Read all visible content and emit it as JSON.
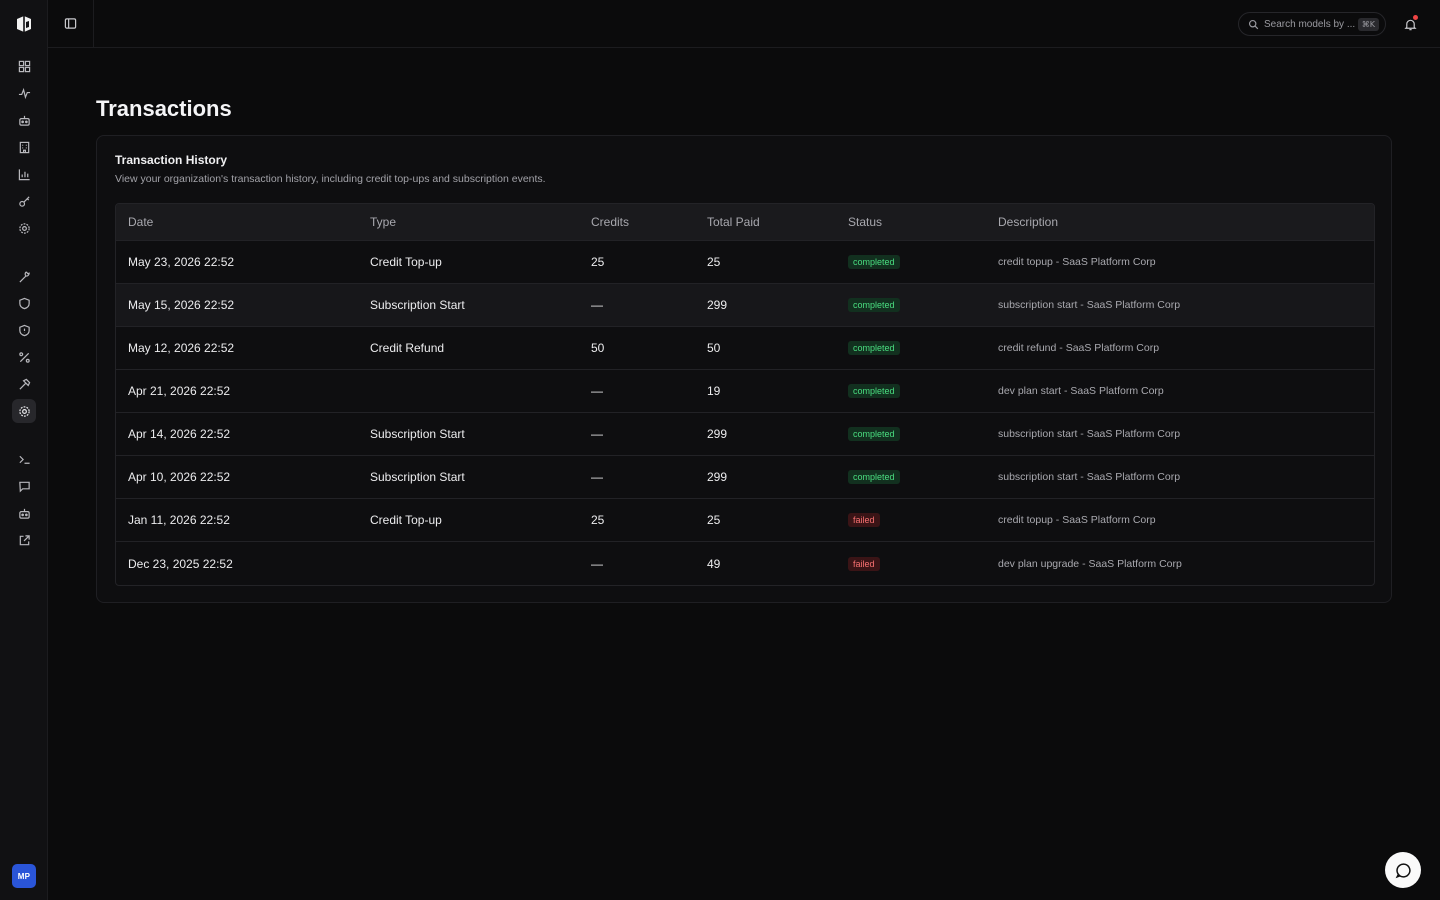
{
  "colors": {
    "background": "#0b0b0c",
    "sidebar": "#111113",
    "accent": "#2a55d8",
    "completed": "#4ade80",
    "failed": "#f87171",
    "notification": "#ef4444"
  },
  "sidebar": {
    "items": [
      {
        "icon": "dashboard-icon"
      },
      {
        "icon": "activity-icon"
      },
      {
        "icon": "bot-icon"
      },
      {
        "icon": "building-icon"
      },
      {
        "icon": "bar-chart-icon"
      },
      {
        "icon": "key-icon"
      },
      {
        "icon": "settings-icon"
      },
      {
        "icon": "wrench-icon"
      },
      {
        "icon": "shield-icon"
      },
      {
        "icon": "shield-alert-icon"
      },
      {
        "icon": "percent-icon"
      },
      {
        "icon": "hammer-icon"
      },
      {
        "icon": "settings-icon",
        "active": true
      },
      {
        "icon": "terminal-icon"
      },
      {
        "icon": "message-icon"
      },
      {
        "icon": "bot-icon"
      },
      {
        "icon": "external-link-icon"
      }
    ],
    "avatar_initials": "MP"
  },
  "topbar": {
    "search_placeholder": "Search models by ...",
    "search_shortcut": "⌘K"
  },
  "page": {
    "title": "Transactions"
  },
  "card": {
    "title": "Transaction History",
    "subtitle": "View your organization's transaction history, including credit top-ups and subscription events."
  },
  "table": {
    "columns": [
      "Date",
      "Type",
      "Credits",
      "Total Paid",
      "Status",
      "Description"
    ],
    "rows": [
      {
        "date": "May 23, 2026 22:52",
        "type": "Credit Top-up",
        "credits": "25",
        "total_paid": "25",
        "status": "completed",
        "description": "credit topup - SaaS Platform Corp"
      },
      {
        "date": "May 15, 2026 22:52",
        "type": "Subscription Start",
        "credits": "—",
        "total_paid": "299",
        "status": "completed",
        "description": "subscription start - SaaS Platform Corp"
      },
      {
        "date": "May 12, 2026 22:52",
        "type": "Credit Refund",
        "credits": "50",
        "total_paid": "50",
        "status": "completed",
        "description": "credit refund - SaaS Platform Corp"
      },
      {
        "date": "Apr 21, 2026 22:52",
        "type": "",
        "credits": "—",
        "total_paid": "19",
        "status": "completed",
        "description": "dev plan start - SaaS Platform Corp"
      },
      {
        "date": "Apr 14, 2026 22:52",
        "type": "Subscription Start",
        "credits": "—",
        "total_paid": "299",
        "status": "completed",
        "description": "subscription start - SaaS Platform Corp"
      },
      {
        "date": "Apr 10, 2026 22:52",
        "type": "Subscription Start",
        "credits": "—",
        "total_paid": "299",
        "status": "completed",
        "description": "subscription start - SaaS Platform Corp"
      },
      {
        "date": "Jan 11, 2026 22:52",
        "type": "Credit Top-up",
        "credits": "25",
        "total_paid": "25",
        "status": "failed",
        "description": "credit topup - SaaS Platform Corp"
      },
      {
        "date": "Dec 23, 2025 22:52",
        "type": "",
        "credits": "—",
        "total_paid": "49",
        "status": "failed",
        "description": "dev plan upgrade - SaaS Platform Corp"
      }
    ]
  }
}
